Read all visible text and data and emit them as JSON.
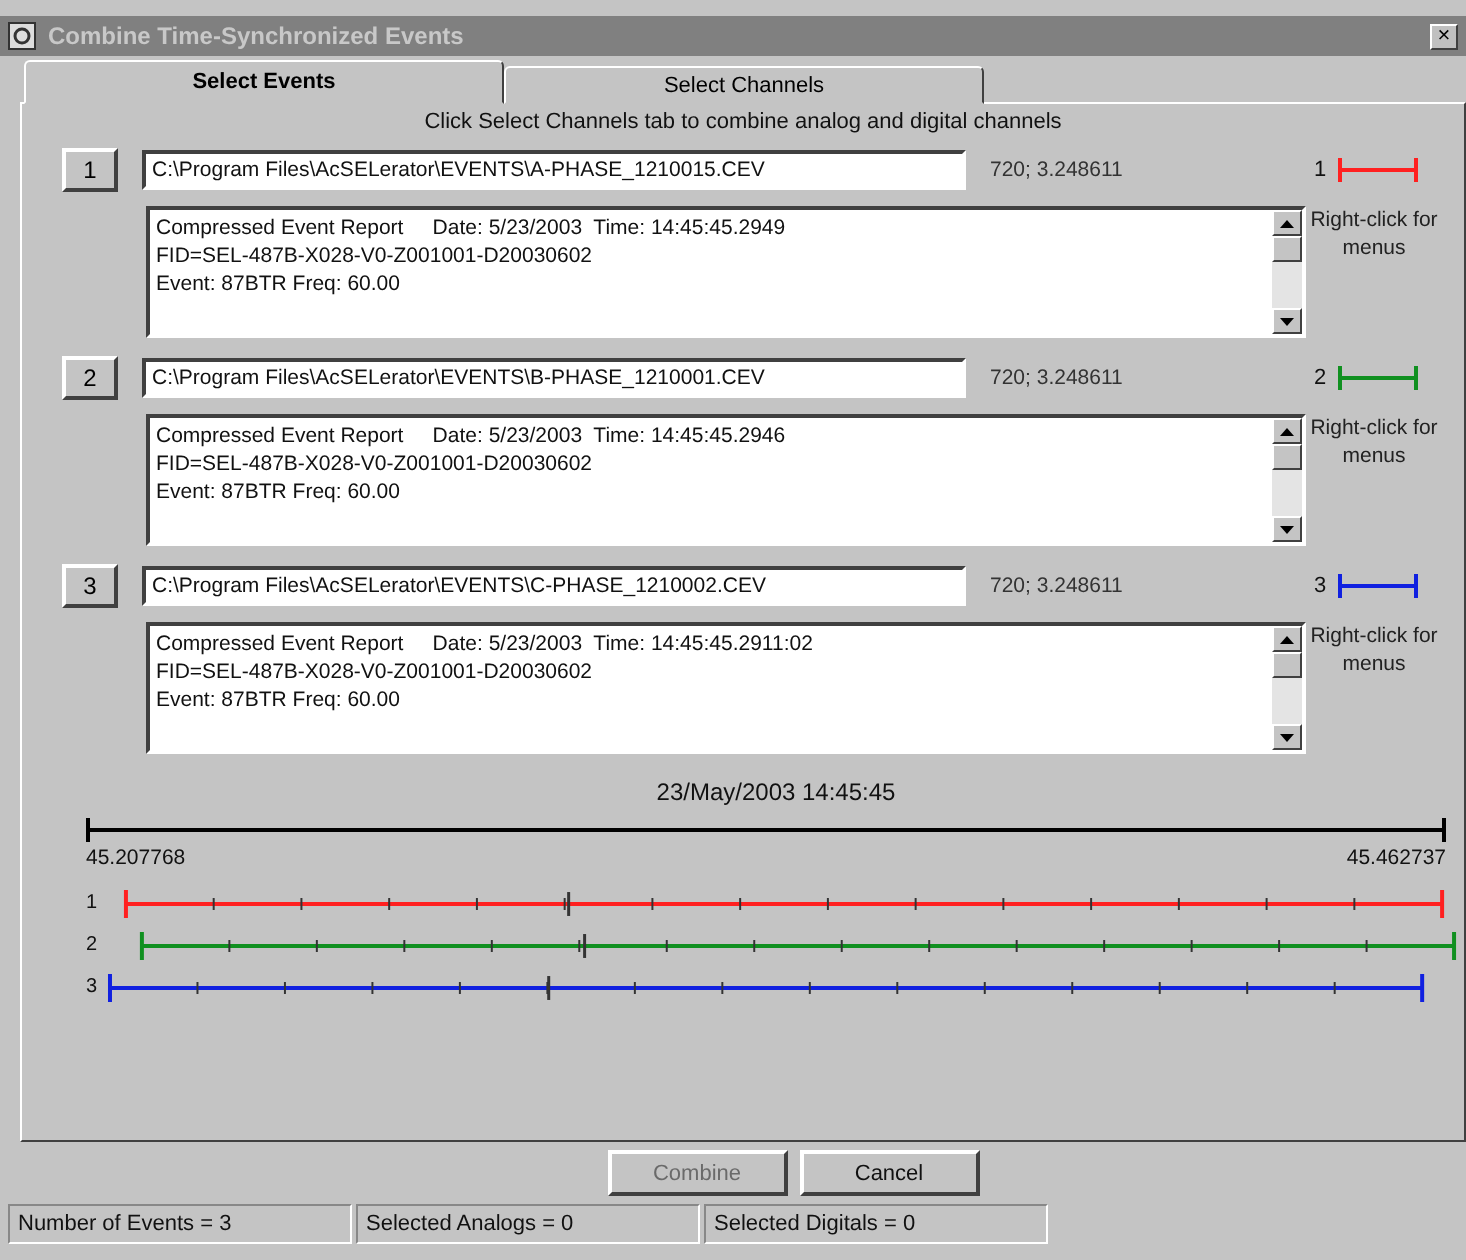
{
  "window": {
    "title": "Combine Time-Synchronized Events",
    "close": "×"
  },
  "tabs": [
    {
      "label": "Select Events",
      "selected": true
    },
    {
      "label": "Select Channels",
      "selected": false
    }
  ],
  "hint": "Click Select Channels tab to combine analog and digital channels",
  "events": [
    {
      "number": "1",
      "path": "C:\\Program Files\\AcSELerator\\EVENTS\\A-PHASE_1210015.CEV",
      "rate": "720; 3.248611",
      "legend": "1",
      "color": "#ff2020",
      "report": [
        "Compressed Event Report     Date: 5/23/2003  Time: 14:45:45.2949",
        "FID=SEL-487B-X028-V0-Z001001-D20030602",
        "Event: 87BTR Freq: 60.00"
      ],
      "menu_hint": "Right-click for menus"
    },
    {
      "number": "2",
      "path": "C:\\Program Files\\AcSELerator\\EVENTS\\B-PHASE_1210001.CEV",
      "rate": "720; 3.248611",
      "legend": "2",
      "color": "#109020",
      "report": [
        "Compressed Event Report     Date: 5/23/2003  Time: 14:45:45.2946",
        "FID=SEL-487B-X028-V0-Z001001-D20030602",
        "Event: 87BTR Freq: 60.00"
      ],
      "menu_hint": "Right-click for menus"
    },
    {
      "number": "3",
      "path": "C:\\Program Files\\AcSELerator\\EVENTS\\C-PHASE_1210002.CEV",
      "rate": "720; 3.248611",
      "legend": "3",
      "color": "#1020e0",
      "report": [
        "Compressed Event Report     Date: 5/23/2003  Time: 14:45:45.2911:02",
        "FID=SEL-487B-X028-V0-Z001001-D20030602",
        "Event: 87BTR Freq: 60.00"
      ],
      "menu_hint": "Right-click for menus"
    }
  ],
  "timeline": {
    "date": "23/May/2003 14:45:45",
    "start": "45.207768",
    "end": "45.462737",
    "tracks": [
      {
        "label": "1",
        "color": "#ff2020"
      },
      {
        "label": "2",
        "color": "#109020"
      },
      {
        "label": "3",
        "color": "#1020e0"
      }
    ]
  },
  "buttons": [
    {
      "label": "Combine",
      "disabled": true
    },
    {
      "label": "Cancel",
      "disabled": false
    }
  ],
  "status_bar": [
    "Number of Events = 3",
    "Selected Analogs = 0",
    "Selected Digitals = 0"
  ]
}
